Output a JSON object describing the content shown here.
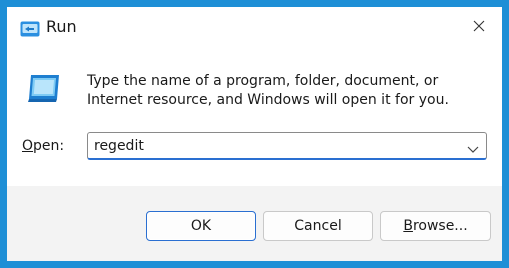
{
  "window": {
    "title": "Run",
    "close_icon": "close-icon",
    "frame_color": "#1e8fd6",
    "accent_color": "#2a6fd1"
  },
  "content": {
    "description": "Type the name of a program, folder, document, or Internet resource, and Windows will open it for you.",
    "open_label_mnemonic": "O",
    "open_label_rest": "pen:",
    "open_value": "regedit"
  },
  "buttons": {
    "ok": "OK",
    "cancel": "Cancel",
    "browse_mnemonic": "B",
    "browse_rest": "rowse..."
  }
}
